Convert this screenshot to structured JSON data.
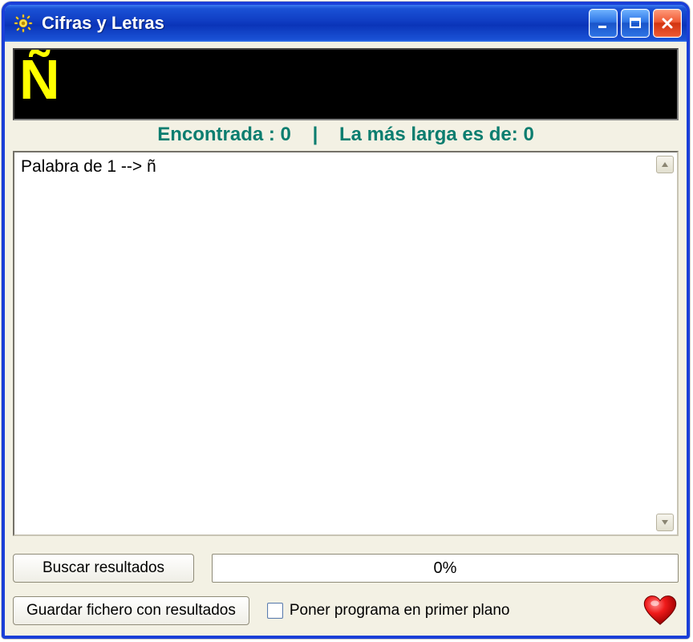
{
  "window": {
    "title": "Cifras y Letras"
  },
  "letters": "Ñ",
  "status": {
    "found_label": "Encontrada :",
    "found_value": "0",
    "sep": "|",
    "longest_label": "La más larga es de:",
    "longest_value": "0"
  },
  "results_text": "Palabra de 1 --> ñ",
  "buttons": {
    "search": "Buscar resultados",
    "save": "Guardar fichero con resultados"
  },
  "progress_text": "0%",
  "foreground_checkbox_label": "Poner programa en primer plano"
}
